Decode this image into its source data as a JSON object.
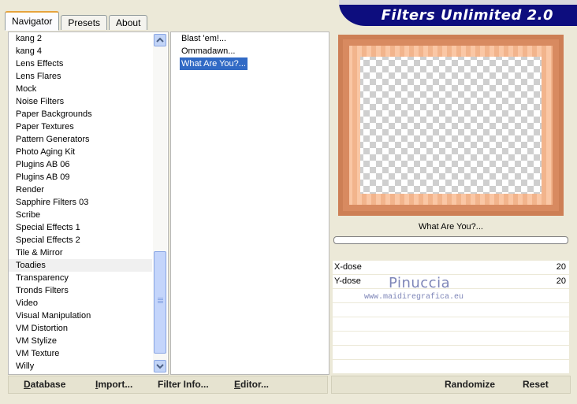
{
  "tabs": [
    "Navigator",
    "Presets",
    "About"
  ],
  "app_title": "Filters Unlimited 2.0",
  "categories": [
    "kang 2",
    "kang 4",
    "Lens Effects",
    "Lens Flares",
    "Mock",
    "Noise Filters",
    "Paper Backgrounds",
    "Paper Textures",
    "Pattern Generators",
    "Photo Aging Kit",
    "Plugins AB 06",
    "Plugins AB 09",
    "Render",
    "Sapphire Filters 03",
    "Scribe",
    "Special Effects 1",
    "Special Effects 2",
    "Tile & Mirror",
    "Toadies",
    "Transparency",
    "Tronds Filters",
    "Video",
    "Visual Manipulation",
    "VM Distortion",
    "VM Stylize",
    "VM Texture",
    "Willy"
  ],
  "selected_category": "Toadies",
  "filters": [
    "Blast 'em!...",
    "Ommadawn...",
    "What Are You?..."
  ],
  "selected_filter": "What Are You?...",
  "filter_name": "What Are You?...",
  "params": [
    {
      "name": "X-dose",
      "value": "20"
    },
    {
      "name": "Y-dose",
      "value": "20"
    }
  ],
  "watermark": {
    "name": "Pinuccia",
    "url": "www.maidiregrafica.eu"
  },
  "buttons_left": [
    {
      "key": "D",
      "rest": "atabase"
    },
    {
      "key": "I",
      "rest": "mport..."
    },
    {
      "key": "",
      "rest": "Filter Info..."
    },
    {
      "key": "E",
      "rest": "ditor..."
    }
  ],
  "buttons_right": [
    "Randomize",
    "Reset"
  ],
  "colors": {
    "title_bar": "#0d0d7e",
    "selection": "#316ac5",
    "frame_outer": "#cd7f55",
    "frame_inner": "#f2b48c"
  }
}
